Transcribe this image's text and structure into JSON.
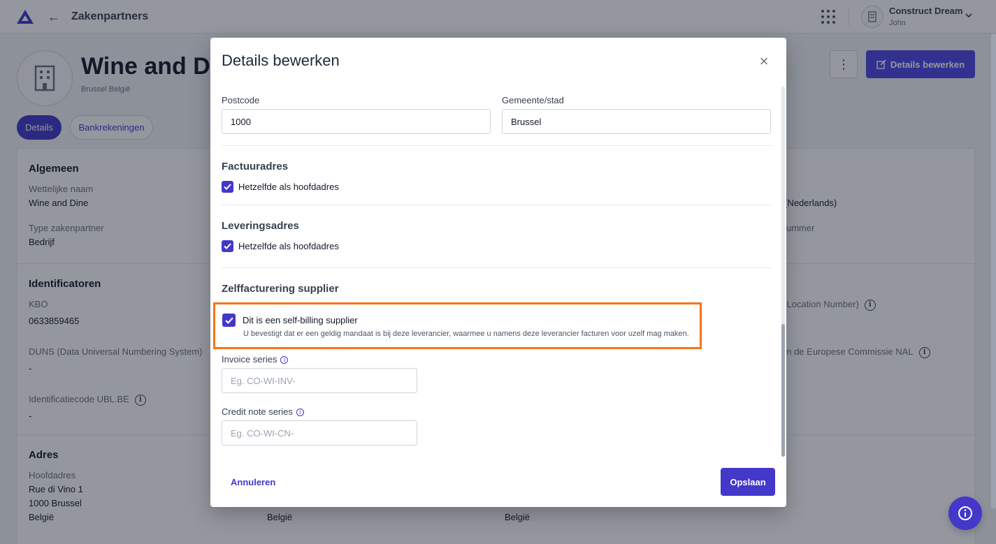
{
  "topbar": {
    "back_label": "←",
    "title": "Zakenpartners",
    "company": "Construct Dream",
    "user": "John"
  },
  "header": {
    "name": "Wine and Dine",
    "subtitle": "Brussel België",
    "more_icon": "⋮",
    "edit_button": "Details bewerken"
  },
  "tabs": [
    {
      "label": "Details",
      "active": true
    },
    {
      "label": "Bankrekeningen",
      "active": false
    }
  ],
  "background": {
    "algemeen": {
      "heading": "Algemeen",
      "legal_name_label": "Wettelijke naam",
      "legal_name_value": "Wine and Dine",
      "type_label": "Type zakenpartner",
      "type_value": "Bedrijf",
      "right_value_1": "s (Nederlands)",
      "right_label_2": "ummer"
    },
    "identificatoren": {
      "heading": "Identificatoren",
      "kbo_label": "KBO",
      "kbo_value": "0633859465",
      "duns_label": "DUNS (Data Universal Numbering System)",
      "duns_value": "-",
      "ublbe_label": "Identificatiecode UBL.BE",
      "ublbe_value": "-",
      "gln_label_partial": "l Location Number)",
      "nal_label_partial": "an de Europese Commissie NAL"
    },
    "adres": {
      "heading": "Adres",
      "hoofdadres_label": "Hoofdadres",
      "street": "Rue di Vino 1",
      "city": "1000 Brussel",
      "country": "België",
      "country_2": "België",
      "country_3": "België"
    }
  },
  "modal": {
    "title": "Details bewerken",
    "close_icon": "×",
    "postcode_label": "Postcode",
    "postcode_value": "1000",
    "city_label": "Gemeente/stad",
    "city_value": "Brussel",
    "invoice_address_heading": "Factuuradres",
    "invoice_same_label": "Hetzelfde als hoofdadres",
    "invoice_same_checked": true,
    "delivery_address_heading": "Leveringsadres",
    "delivery_same_label": "Hetzelfde als hoofdadres",
    "delivery_same_checked": true,
    "self_billing_heading": "Zelffacturering supplier",
    "self_billing_label": "Dit is een self-billing supplier",
    "self_billing_checked": true,
    "self_billing_desc": "U bevestigt dat er een geldig mandaat is bij deze leverancier, waarmee u namens deze leverancier facturen voor uzelf mag maken.",
    "invoice_series_label": "Invoice series",
    "invoice_series_placeholder": "Eg. CO-WI-INV-",
    "credit_note_label": "Credit note series",
    "credit_note_placeholder": "Eg. CO-WI-CN-",
    "cancel_label": "Annuleren",
    "save_label": "Opslaan"
  },
  "colors": {
    "primary": "#4338ca",
    "highlight": "#f97316"
  },
  "icons": {
    "logo": "triangle-logo-icon",
    "apps": "apps-grid-icon",
    "avatar": "building-icon",
    "info": "info-icon",
    "help": "help-info-icon"
  }
}
